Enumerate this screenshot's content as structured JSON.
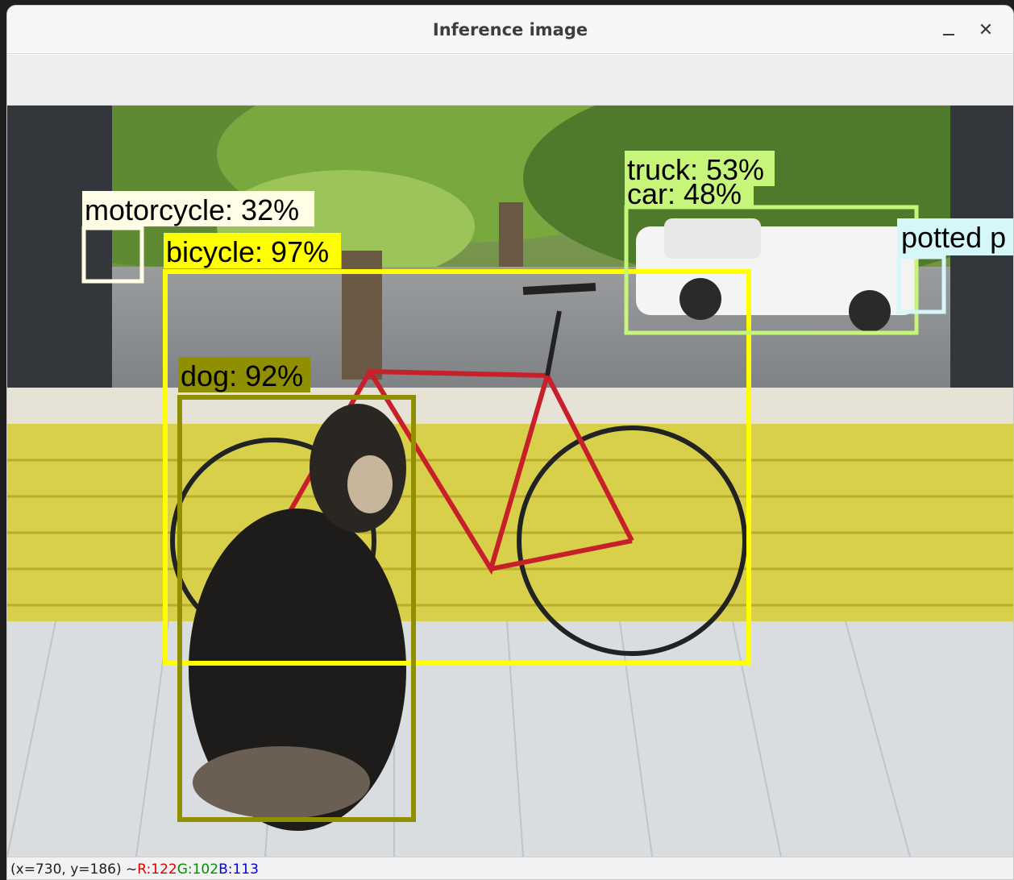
{
  "window": {
    "title": "Inference image",
    "minimize_icon": "minimize-icon",
    "close_icon": "close-icon",
    "close_glyph": "✕"
  },
  "detections": [
    {
      "label": "bicycle: 97%",
      "color": "#ffff00"
    },
    {
      "label": "dog: 92%",
      "color": "#8f8f00"
    },
    {
      "label": "truck: 53%",
      "color": "#c6f57a"
    },
    {
      "label": "car: 48%",
      "color": "#c6f57a"
    },
    {
      "label": "motorcycle: 32%",
      "color": "#fffde6"
    },
    {
      "label": "potted p",
      "color": "#d6f7fa"
    }
  ],
  "status": {
    "coords": "(x=730, y=186) ~",
    "r": "R:122",
    "g": "G:102",
    "b": "B:113"
  }
}
